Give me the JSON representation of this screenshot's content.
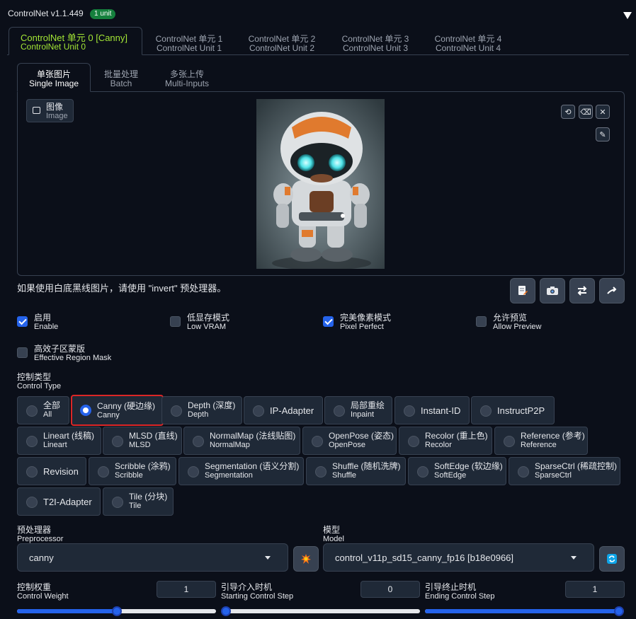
{
  "header": {
    "title": "ControlNet v1.1.449",
    "badge": "1 unit",
    "collapse_icon": "triangle-down-icon"
  },
  "unit_tabs": [
    {
      "cn": "ControlNet 单元 0 [Canny]",
      "en": "ControlNet Unit 0",
      "active": true
    },
    {
      "cn": "ControlNet 单元 1",
      "en": "ControlNet Unit 1"
    },
    {
      "cn": "ControlNet 单元 2",
      "en": "ControlNet Unit 2"
    },
    {
      "cn": "ControlNet 单元 3",
      "en": "ControlNet Unit 3"
    },
    {
      "cn": "ControlNet 单元 4",
      "en": "ControlNet Unit 4"
    }
  ],
  "input_tabs": [
    {
      "cn": "单张图片",
      "en": "Single Image",
      "active": true
    },
    {
      "cn": "批量处理",
      "en": "Batch"
    },
    {
      "cn": "多张上传",
      "en": "Multi-Inputs"
    }
  ],
  "image_label": {
    "cn": "图像",
    "en": "Image"
  },
  "image_tools": [
    "rotate-icon",
    "eraser-icon",
    "close-icon",
    "brush-icon"
  ],
  "hint": "如果使用白底黑线图片，请使用 \"invert\" 预处理器。",
  "action_icons": [
    "edit-document-icon",
    "camera-icon",
    "swap-icon",
    "send-arrow-icon"
  ],
  "options": [
    {
      "cn": "启用",
      "en": "Enable",
      "checked": true
    },
    {
      "cn": "低显存模式",
      "en": "Low VRAM",
      "checked": false
    },
    {
      "cn": "完美像素模式",
      "en": "Pixel Perfect",
      "checked": true
    },
    {
      "cn": "允许预览",
      "en": "Allow Preview",
      "checked": false
    },
    {
      "cn": "高效子区蒙版",
      "en": "Effective Region Mask",
      "checked": false
    }
  ],
  "control_type": {
    "label_cn": "控制类型",
    "label_en": "Control Type",
    "items": [
      {
        "cn": "全部",
        "en": "All"
      },
      {
        "cn": "Canny (硬边缘)",
        "en": "Canny",
        "selected": true
      },
      {
        "cn": "Depth (深度)",
        "en": "Depth"
      },
      {
        "single": "IP-Adapter"
      },
      {
        "cn": "局部重绘",
        "en": "Inpaint"
      },
      {
        "single": "Instant-ID"
      },
      {
        "single": "InstructP2P"
      },
      {
        "cn": "Lineart (线稿)",
        "en": "Lineart"
      },
      {
        "cn": "MLSD (直线)",
        "en": "MLSD"
      },
      {
        "cn": "NormalMap (法线贴图)",
        "en": "NormalMap"
      },
      {
        "cn": "OpenPose (姿态)",
        "en": "OpenPose"
      },
      {
        "cn": "Recolor (重上色)",
        "en": "Recolor"
      },
      {
        "cn": "Reference (参考)",
        "en": "Reference"
      },
      {
        "single": "Revision"
      },
      {
        "cn": "Scribble (涂鸦)",
        "en": "Scribble"
      },
      {
        "cn": "Segmentation (语义分割)",
        "en": "Segmentation"
      },
      {
        "cn": "Shuffle (随机洗牌)",
        "en": "Shuffle"
      },
      {
        "cn": "SoftEdge (软边缘)",
        "en": "SoftEdge"
      },
      {
        "cn": "SparseCtrl (稀疏控制)",
        "en": "SparseCtrl"
      },
      {
        "single": "T2I-Adapter"
      },
      {
        "cn": "Tile (分块)",
        "en": "Tile"
      }
    ]
  },
  "preprocessor": {
    "label_cn": "预处理器",
    "label_en": "Preprocessor",
    "value": "canny",
    "run_icon": "explosion-icon"
  },
  "model": {
    "label_cn": "模型",
    "label_en": "Model",
    "value": "control_v11p_sd15_canny_fp16 [b18e0966]",
    "refresh_icon": "refresh-icon"
  },
  "control_weight": {
    "label_cn": "控制权重",
    "label_en": "Control Weight",
    "value": "1",
    "level": 0.5
  },
  "start_step": {
    "label_cn": "引导介入时机",
    "label_en": "Starting Control Step",
    "value": "0",
    "level": 0.0
  },
  "end_step": {
    "label_cn": "引导终止时机",
    "label_en": "Ending Control Step",
    "value": "1",
    "level": 1.0
  },
  "colors": {
    "accent": "#2563eb",
    "active_tab_text": "#a3e635",
    "badge": "#15803d",
    "highlight_border": "#dc2626"
  }
}
